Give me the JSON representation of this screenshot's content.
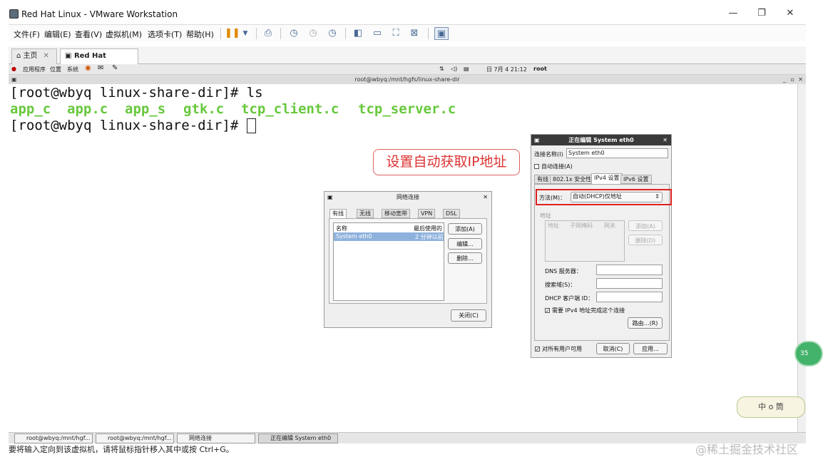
{
  "window": {
    "title": "Red Hat Linux - VMware Workstation",
    "minimize": "—",
    "restore": "❐",
    "close": "✕"
  },
  "menu": [
    "文件(F)",
    "编辑(E)",
    "查看(V)",
    "虚拟机(M)",
    "选项卡(T)",
    "帮助(H)"
  ],
  "tabs": [
    {
      "label": "主页"
    },
    {
      "label": "Red Hat Linux"
    }
  ],
  "guest_panel": {
    "apps": "应用程序",
    "places": "位置",
    "system": "系统",
    "datetime": "日 7月  4 21:12",
    "user": "root"
  },
  "terminal": {
    "title": "root@wbyq:/mnt/hgfs/linux-share-dir",
    "line1": "[root@wbyq linux-share-dir]# ls",
    "files": [
      "app_c",
      "app.c",
      "app_s",
      "gtk.c",
      "tcp_client.c",
      "tcp_server.c"
    ],
    "prompt": "[root@wbyq linux-share-dir]# "
  },
  "annotation": "设置自动获取IP地址",
  "net_dialog": {
    "title": "网络连接",
    "tabs": [
      "有线",
      "无线",
      "移动宽带",
      "VPN",
      "DSL"
    ],
    "col_name": "名称",
    "col_last": "最后使用的",
    "row_name": "System eth0",
    "row_last": "2 分钟以前",
    "add": "添加(A)",
    "edit": "编辑...",
    "delete": "删除...",
    "close": "关闭(C)"
  },
  "edit_dialog": {
    "title": "正在编辑 System eth0",
    "conn_name_label": "连接名称(I)",
    "conn_name_value": "System eth0",
    "auto_connect": "自动连接(A)",
    "tabs": [
      "有线",
      "802.1x 安全性",
      "IPv4 设置",
      "IPv6 设置"
    ],
    "method_label": "方法(M)：",
    "method_value": "自动(DHCP)仅地址",
    "address_section": "地址",
    "addr_cols": [
      "地址",
      "子网掩码",
      "网关"
    ],
    "addr_add": "添加(A)",
    "addr_del": "删除(D)",
    "dns_label": "DNS 服务器：",
    "search_label": "搜索域(S)：",
    "dhcp_label": "DHCP 客户端 ID：",
    "require_ipv4": "需要 IPv4 地址完成这个连接",
    "routes": "路由…(R)",
    "all_users": "对所有用户可用",
    "cancel": "取消(C)",
    "apply": "应用..."
  },
  "taskbar": [
    "root@wbyq:/mnt/hgf...",
    "root@wbyq:/mnt/hgf...",
    "网络连接",
    "正在编辑 System eth0"
  ],
  "statusbar": "要将输入定向到该虚拟机，请将鼠标指针移入其中或按 Ctrl+G。",
  "watermark": "@稀土掘金技术社区",
  "green_ball": "35",
  "sticker": "中 o 筒"
}
